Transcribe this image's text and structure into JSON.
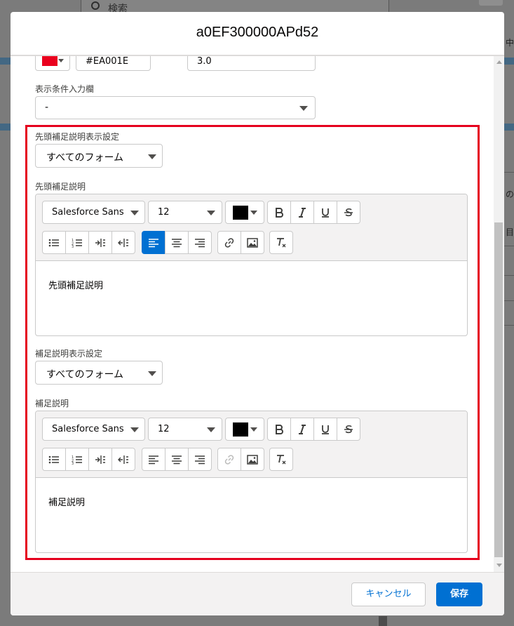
{
  "background": {
    "search_placeholder": "検索",
    "right_texts": [
      "中",
      "の",
      "目"
    ]
  },
  "modal": {
    "title": "a0EF300000APd52",
    "color_hex_value": "#EA001E",
    "number_value": "3.0",
    "display_condition": {
      "label": "表示条件入力欄",
      "value": "-"
    },
    "header_help": {
      "display_label": "先頭補足説明表示設定",
      "display_value": "すべてのフォーム",
      "text_label": "先頭補足説明",
      "editor": {
        "font_family": "Salesforce Sans",
        "font_size": "12",
        "content": "先頭補足説明",
        "active_alignment": "left",
        "link_enabled": true
      }
    },
    "help": {
      "display_label": "補足説明表示設定",
      "display_value": "すべてのフォーム",
      "text_label": "補足説明",
      "editor": {
        "font_family": "Salesforce Sans",
        "font_size": "12",
        "content": "補足説明",
        "active_alignment": "none",
        "link_enabled": false
      }
    },
    "footer": {
      "cancel_label": "キャンセル",
      "save_label": "保存"
    }
  },
  "colors": {
    "brand": "#0070d2",
    "highlight_border": "#e5001e",
    "swatch_red": "#ea001e"
  },
  "icons": [
    "bold-icon",
    "italic-icon",
    "underline-icon",
    "strikethrough-icon",
    "bulleted-list-icon",
    "numbered-list-icon",
    "indent-icon",
    "outdent-icon",
    "align-left-icon",
    "align-center-icon",
    "align-right-icon",
    "link-icon",
    "image-icon",
    "clear-formatting-icon"
  ]
}
